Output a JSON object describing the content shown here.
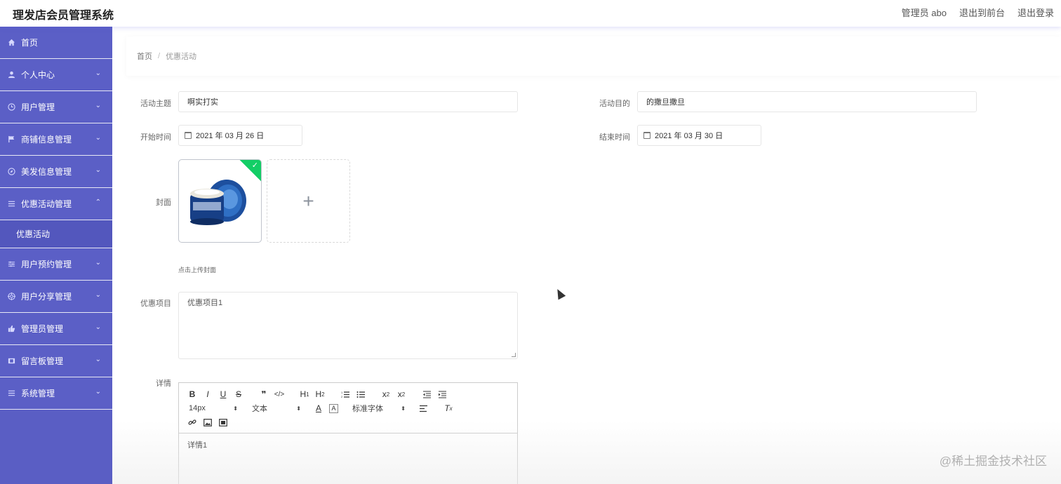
{
  "header": {
    "app_title": "理发店会员管理系统",
    "links": [
      "管理员 abo",
      "退出到前台",
      "退出登录"
    ]
  },
  "sidebar": {
    "items": [
      {
        "label": "首页",
        "icon": "home-icon"
      },
      {
        "label": "个人中心",
        "icon": "user-icon"
      },
      {
        "label": "用户管理",
        "icon": "clock-icon"
      },
      {
        "label": "商铺信息管理",
        "icon": "flag-icon"
      },
      {
        "label": "美发信息管理",
        "icon": "compass-icon"
      },
      {
        "label": "优惠活动管理",
        "icon": "list-icon"
      },
      {
        "label": "用户预约管理",
        "icon": "sliders-icon"
      },
      {
        "label": "用户分享管理",
        "icon": "target-icon"
      },
      {
        "label": "管理员管理",
        "icon": "thumb-icon"
      },
      {
        "label": "留言板管理",
        "icon": "film-icon"
      },
      {
        "label": "系统管理",
        "icon": "menu-icon"
      }
    ],
    "submenu_active": "优惠活动"
  },
  "breadcrumb": {
    "home": "首页",
    "separator": "/",
    "current": "优惠活动"
  },
  "form": {
    "topic_label": "活动主题",
    "topic_value": "啊实打实",
    "purpose_label": "活动目的",
    "purpose_value": "的撒旦撒旦",
    "start_label": "开始时间",
    "start_value": "2021 年 03 月 26 日",
    "end_label": "结束时间",
    "end_value": "2021 年 03 月 30 日",
    "cover_label": "封面",
    "cover_tip": "点击上传封面",
    "discount_label": "优惠项目",
    "discount_value": "优惠项目1",
    "detail_label": "详情",
    "detail_value": "详情1"
  },
  "editor": {
    "font_size": "14px",
    "text_type": "文本",
    "font_family": "标准字体"
  },
  "watermark": "@稀土掘金技术社区"
}
